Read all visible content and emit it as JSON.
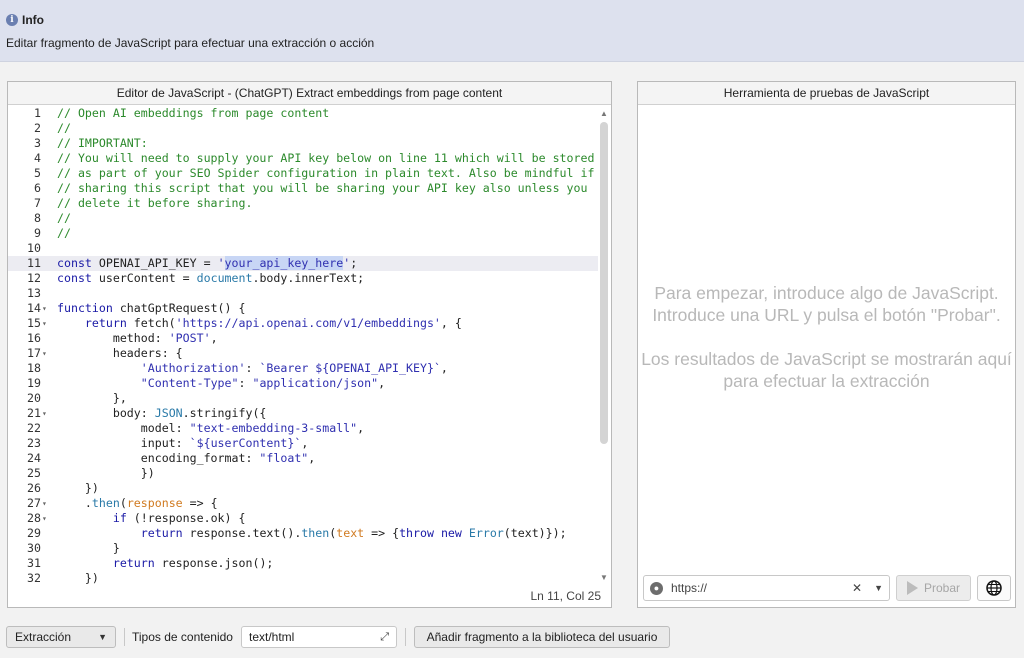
{
  "info": {
    "title": "Info",
    "description": "Editar fragmento de JavaScript para efectuar una extracción o acción",
    "icon": "info-icon"
  },
  "editor": {
    "title": "Editor de JavaScript - (ChatGPT) Extract embeddings from page content",
    "status": "Ln 11, Col 25",
    "active_line": 11,
    "lines": [
      {
        "n": "1",
        "fold": "",
        "parts": [
          {
            "t": "// Open AI embeddings from page content",
            "c": "comment"
          }
        ]
      },
      {
        "n": "2",
        "fold": "",
        "parts": [
          {
            "t": "//",
            "c": "comment"
          }
        ]
      },
      {
        "n": "3",
        "fold": "",
        "parts": [
          {
            "t": "// IMPORTANT:",
            "c": "comment"
          }
        ]
      },
      {
        "n": "4",
        "fold": "",
        "parts": [
          {
            "t": "// You will need to supply your API key below on line 11 which will be stored",
            "c": "comment"
          }
        ]
      },
      {
        "n": "5",
        "fold": "",
        "parts": [
          {
            "t": "// as part of your SEO Spider configuration in plain text. Also be mindful if",
            "c": "comment"
          }
        ]
      },
      {
        "n": "6",
        "fold": "",
        "parts": [
          {
            "t": "// sharing this script that you will be sharing your API key also unless you",
            "c": "comment"
          }
        ]
      },
      {
        "n": "7",
        "fold": "",
        "parts": [
          {
            "t": "// delete it before sharing.",
            "c": "comment"
          }
        ]
      },
      {
        "n": "8",
        "fold": "",
        "parts": [
          {
            "t": "//",
            "c": "comment"
          }
        ]
      },
      {
        "n": "9",
        "fold": "",
        "parts": [
          {
            "t": "//",
            "c": "comment"
          }
        ]
      },
      {
        "n": "10",
        "fold": "",
        "parts": []
      },
      {
        "n": "11",
        "fold": "",
        "parts": [
          {
            "t": "const ",
            "c": "kw"
          },
          {
            "t": "OPENAI_API_KEY = ",
            "c": "plain"
          },
          {
            "t": "'",
            "c": "str"
          },
          {
            "t": "your_api_key_here",
            "c": "hl"
          },
          {
            "t": "'",
            "c": "str"
          },
          {
            "t": ";",
            "c": "plain"
          }
        ]
      },
      {
        "n": "12",
        "fold": "",
        "parts": [
          {
            "t": "const ",
            "c": "kw"
          },
          {
            "t": "userContent = ",
            "c": "plain"
          },
          {
            "t": "document",
            "c": "var"
          },
          {
            "t": ".body.innerText;",
            "c": "plain"
          }
        ]
      },
      {
        "n": "13",
        "fold": "",
        "parts": []
      },
      {
        "n": "14",
        "fold": "▾",
        "parts": [
          {
            "t": "function ",
            "c": "kw"
          },
          {
            "t": "chatGptRequest() {",
            "c": "plain"
          }
        ]
      },
      {
        "n": "15",
        "fold": "▾",
        "parts": [
          {
            "t": "    return ",
            "c": "kw"
          },
          {
            "t": "fetch(",
            "c": "plain"
          },
          {
            "t": "'https://api.openai.com/v1/embeddings'",
            "c": "str"
          },
          {
            "t": ", {",
            "c": "plain"
          }
        ]
      },
      {
        "n": "16",
        "fold": "",
        "parts": [
          {
            "t": "        method: ",
            "c": "plain"
          },
          {
            "t": "'POST'",
            "c": "str"
          },
          {
            "t": ",",
            "c": "plain"
          }
        ]
      },
      {
        "n": "17",
        "fold": "▾",
        "parts": [
          {
            "t": "        headers: {",
            "c": "plain"
          }
        ]
      },
      {
        "n": "18",
        "fold": "",
        "parts": [
          {
            "t": "            ",
            "c": "plain"
          },
          {
            "t": "'Authorization'",
            "c": "str"
          },
          {
            "t": ": ",
            "c": "plain"
          },
          {
            "t": "`Bearer ${OPENAI_API_KEY}`",
            "c": "str"
          },
          {
            "t": ",",
            "c": "plain"
          }
        ]
      },
      {
        "n": "19",
        "fold": "",
        "parts": [
          {
            "t": "            ",
            "c": "plain"
          },
          {
            "t": "\"Content-Type\"",
            "c": "str"
          },
          {
            "t": ": ",
            "c": "plain"
          },
          {
            "t": "\"application/json\"",
            "c": "str"
          },
          {
            "t": ",",
            "c": "plain"
          }
        ]
      },
      {
        "n": "20",
        "fold": "",
        "parts": [
          {
            "t": "        },",
            "c": "plain"
          }
        ]
      },
      {
        "n": "21",
        "fold": "▾",
        "parts": [
          {
            "t": "        body: ",
            "c": "plain"
          },
          {
            "t": "JSON",
            "c": "var"
          },
          {
            "t": ".stringify({",
            "c": "plain"
          }
        ]
      },
      {
        "n": "22",
        "fold": "",
        "parts": [
          {
            "t": "            model: ",
            "c": "plain"
          },
          {
            "t": "\"text-embedding-3-small\"",
            "c": "str"
          },
          {
            "t": ",",
            "c": "plain"
          }
        ]
      },
      {
        "n": "23",
        "fold": "",
        "parts": [
          {
            "t": "            input: ",
            "c": "plain"
          },
          {
            "t": "`${userContent}`",
            "c": "str"
          },
          {
            "t": ",",
            "c": "plain"
          }
        ]
      },
      {
        "n": "24",
        "fold": "",
        "parts": [
          {
            "t": "            encoding_format: ",
            "c": "plain"
          },
          {
            "t": "\"float\"",
            "c": "str"
          },
          {
            "t": ",",
            "c": "plain"
          }
        ]
      },
      {
        "n": "25",
        "fold": "",
        "parts": [
          {
            "t": "            })",
            "c": "plain"
          }
        ]
      },
      {
        "n": "26",
        "fold": "",
        "parts": [
          {
            "t": "    })",
            "c": "plain"
          }
        ]
      },
      {
        "n": "27",
        "fold": "▾",
        "parts": [
          {
            "t": "    .",
            "c": "plain"
          },
          {
            "t": "then",
            "c": "var"
          },
          {
            "t": "(",
            "c": "plain"
          },
          {
            "t": "response",
            "c": "orange"
          },
          {
            "t": " => {",
            "c": "plain"
          }
        ]
      },
      {
        "n": "28",
        "fold": "▾",
        "parts": [
          {
            "t": "        ",
            "c": "plain"
          },
          {
            "t": "if ",
            "c": "kw"
          },
          {
            "t": "(!response.ok) {",
            "c": "plain"
          }
        ]
      },
      {
        "n": "29",
        "fold": "",
        "parts": [
          {
            "t": "            ",
            "c": "plain"
          },
          {
            "t": "return ",
            "c": "kw"
          },
          {
            "t": "response.text().",
            "c": "plain"
          },
          {
            "t": "then",
            "c": "var"
          },
          {
            "t": "(",
            "c": "plain"
          },
          {
            "t": "text",
            "c": "orange"
          },
          {
            "t": " => {",
            "c": "plain"
          },
          {
            "t": "throw new ",
            "c": "kw"
          },
          {
            "t": "Error",
            "c": "var"
          },
          {
            "t": "(text)});",
            "c": "plain"
          }
        ]
      },
      {
        "n": "30",
        "fold": "",
        "parts": [
          {
            "t": "        }",
            "c": "plain"
          }
        ]
      },
      {
        "n": "31",
        "fold": "",
        "parts": [
          {
            "t": "        ",
            "c": "plain"
          },
          {
            "t": "return ",
            "c": "kw"
          },
          {
            "t": "response.json();",
            "c": "plain"
          }
        ]
      },
      {
        "n": "32",
        "fold": "",
        "parts": [
          {
            "t": "    })",
            "c": "plain"
          }
        ]
      }
    ]
  },
  "tester": {
    "title": "Herramienta de pruebas de JavaScript",
    "placeholder_1": "Para empezar, introduce algo de JavaScript. Introduce una URL y pulsa el botón \"Probar\".",
    "placeholder_2": "Los resultados de JavaScript se mostrarán aquí para efectuar la extracción",
    "url_value": "https://",
    "probar_label": "Probar"
  },
  "bottom": {
    "type_select": "Extracción",
    "content_types_label": "Tipos de contenido",
    "content_types_value": "text/html",
    "add_snippet_label": "Añadir fragmento a la biblioteca del usuario"
  },
  "colors": {
    "banner": "#dde1ee",
    "comment": "#2c8a2c",
    "keyword": "#1a1aa6",
    "highlight": "#c8d6f5"
  }
}
